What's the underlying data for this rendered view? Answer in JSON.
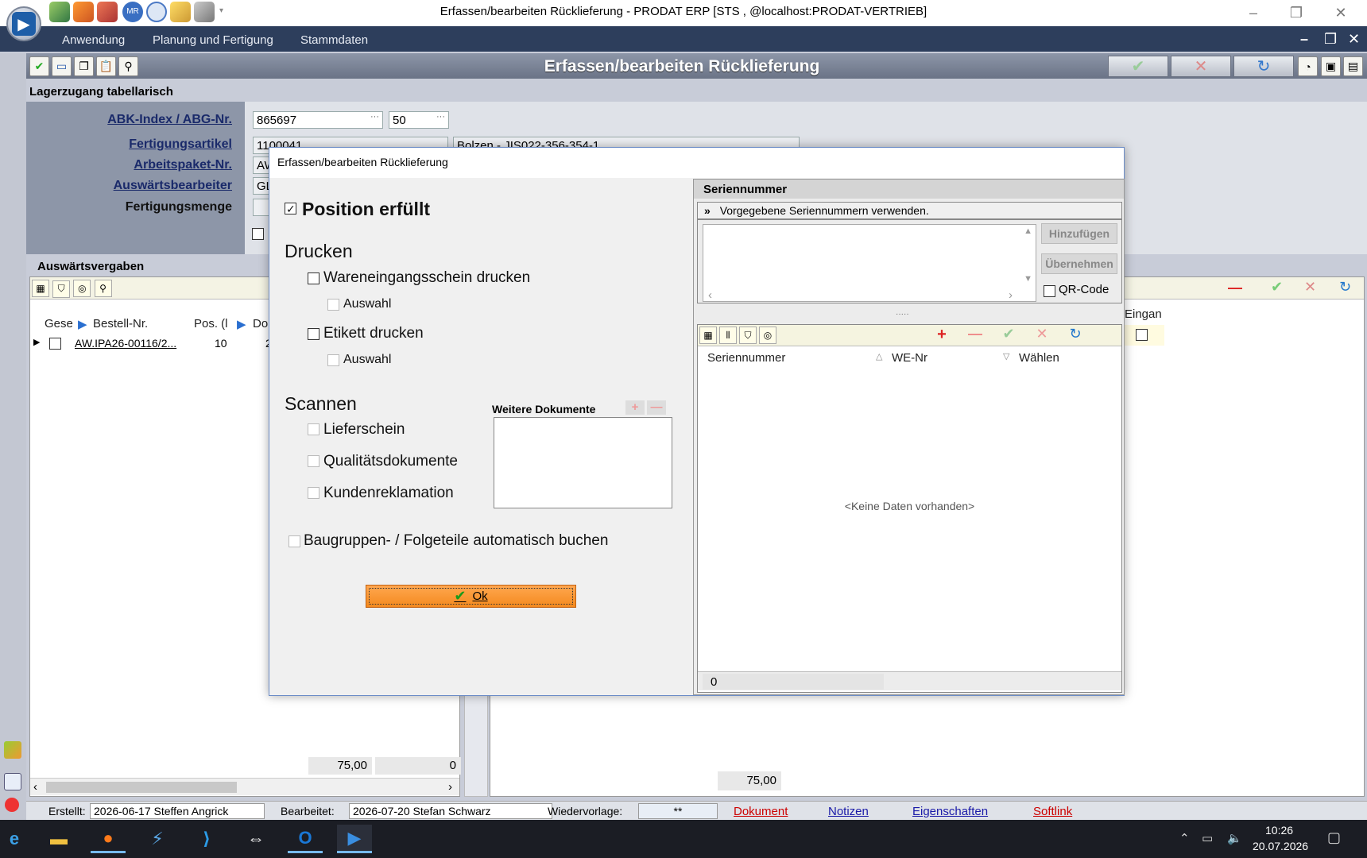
{
  "window": {
    "title": "Erfassen/bearbeiten Rücklieferung - PRODAT ERP   [STS , @localhost:PRODAT-VERTRIEB]"
  },
  "menu": [
    "Anwendung",
    "Planung und Fertigung",
    "Stammdaten"
  ],
  "form": {
    "title": "Erfassen/bearbeiten Rücklieferung",
    "section": "Lagerzugang tabellarisch"
  },
  "fields": {
    "abk_label": "ABK-Index / ABG-Nr.",
    "abk_value": "865697",
    "abg_value": "50",
    "artikel_label": "Fertigungsartikel",
    "artikel_value": "1100041",
    "artikel_desc": "Bolzen - JIS022-356-354-1",
    "paket_label": "Arbeitspaket-Nr.",
    "paket_value": "AW",
    "bearbeiter_label": "Auswärtsbearbeiter",
    "bearbeiter_value": "GL",
    "menge_label": "Fertigungsmenge"
  },
  "vergaben": {
    "section": "Auswärtsvergaben",
    "headers": [
      "Gese",
      "Bestell-Nr.",
      "Pos. (l",
      "Do"
    ],
    "row": {
      "bestell": "AW.IPA26-00116/2...",
      "pos": "10",
      "do": "2"
    },
    "sum_left": "75,00",
    "sum_right": "0",
    "right_header": "Eingan",
    "right_sum": "75,00"
  },
  "status": {
    "erstellt_label": "Erstellt:",
    "erstellt_value": "2026-06-17  Steffen Angrick",
    "bearbeitet_label": "Bearbeitet:",
    "bearbeitet_value": "2026-07-20  Stefan Schwarz",
    "wiedervorlage_label": "Wiedervorlage:",
    "wiedervorlage_value": "**",
    "links": [
      "Dokument",
      "Notizen",
      "Eigenschaften",
      "Softlink"
    ]
  },
  "dialog": {
    "title": "Erfassen/bearbeiten Rücklieferung",
    "position_erfuellt": "Position erfüllt",
    "drucken": "Drucken",
    "wareneingang": "Wareneingangsschein drucken",
    "auswahl1": "Auswahl",
    "etikett": "Etikett drucken",
    "auswahl2": "Auswahl",
    "scannen": "Scannen",
    "lieferschein": "Lieferschein",
    "qualitaet": "Qualitätsdokumente",
    "kunden": "Kundenreklamation",
    "weitere": "Weitere Dokumente",
    "baugruppen": "Baugruppen- / Folgeteile automatisch buchen",
    "ok": "Ok"
  },
  "serial": {
    "title": "Seriennummer",
    "vorgegeben": "Vorgegebene Seriennummern verwenden.",
    "hinzufuegen": "Hinzufügen",
    "uebernehmen": "Übernehmen",
    "qr": "QR-Code",
    "columns": [
      "Seriennummer",
      "WE-Nr",
      "Wählen"
    ],
    "empty": "<Keine Daten vorhanden>",
    "count": "0"
  },
  "taskbar": {
    "time": "10:26",
    "date": "20.07.2026"
  },
  "colors": {
    "menubar": "#2d3e5c",
    "accent_orange": "#f48a1e",
    "link_red": "#cc0000",
    "link_blue": "#1a1aa8"
  }
}
